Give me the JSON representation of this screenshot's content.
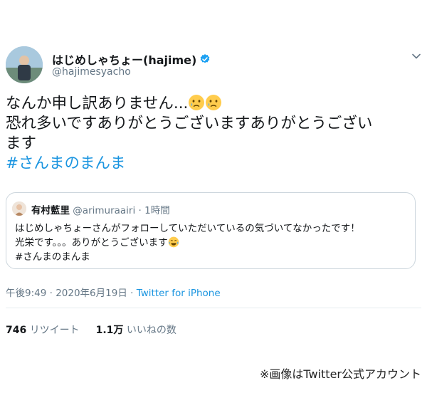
{
  "author": {
    "display_name": "はじめしゃちょー(hajime)",
    "handle": "@hajimesyacho",
    "avatar_icon": "profile-photo",
    "verified_icon": "verified-badge-icon",
    "verified_color": "#1da1f2"
  },
  "tweet": {
    "line1_text": "なんか申し訳ありません...",
    "line2_text": "恐れ多いですありがとうございますありがとうござい",
    "line3_text": "ます",
    "hashtag": "#さんまのまんま",
    "emoji_icon": "crying-face-emoji"
  },
  "quoted": {
    "display_name": "有村藍里",
    "handle_time": "@arimuraairi · 1時間",
    "line1": "はじめしゃちょーさんがフォローしていただいているの気づいてなかったです！",
    "line2": "光栄です。。。ありがとうございます",
    "line3": "#さんまのまんま",
    "emoji_icon": "tears-of-joy-emoji"
  },
  "meta": {
    "timestamp": "午後9:49 · 2020年6月19日 · ",
    "source": "Twitter for iPhone"
  },
  "stats": {
    "retweets_count": "746",
    "retweets_label": "リツイート",
    "likes_count": "1.1万",
    "likes_label": "いいねの数"
  },
  "credit": "※画像はTwitter公式アカウント",
  "colors": {
    "link": "#1b95e0",
    "muted": "#657786",
    "border": "#ccd6dd"
  }
}
